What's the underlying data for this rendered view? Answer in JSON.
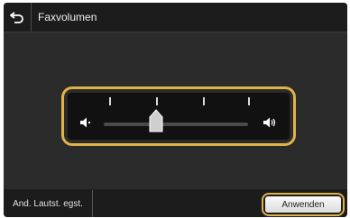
{
  "header": {
    "title": "Faxvolumen",
    "back_icon": "back-arrow-icon"
  },
  "volume_slider": {
    "levels": 5,
    "current_level": 2,
    "low_icon": "speaker-low-icon",
    "high_icon": "speaker-high-icon"
  },
  "footer": {
    "left_button_label": "And. Lautst. egst.",
    "apply_button_label": "Anwenden"
  },
  "colors": {
    "highlight": "#e0b24a",
    "screen_bg": "#2b2b2b",
    "panel_bg": "#111111"
  }
}
